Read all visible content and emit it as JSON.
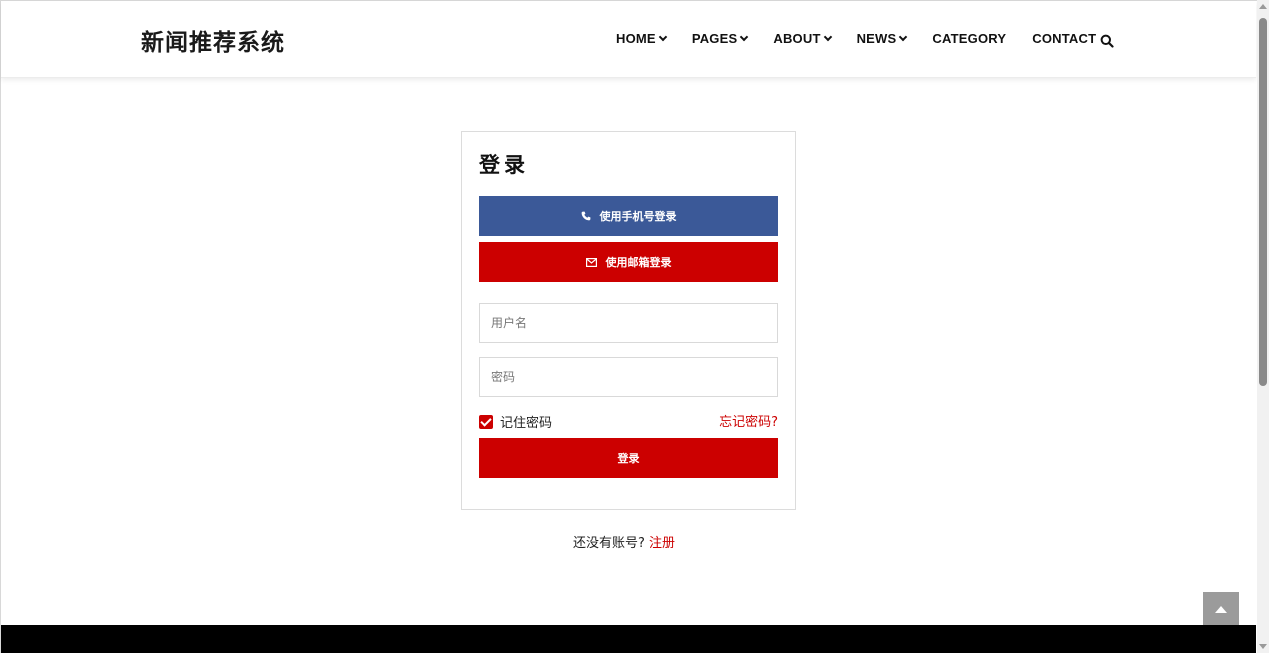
{
  "header": {
    "brand": "新闻推荐系统",
    "nav": [
      {
        "label": "HOME",
        "has_dropdown": true
      },
      {
        "label": "PAGES",
        "has_dropdown": true
      },
      {
        "label": "ABOUT",
        "has_dropdown": true
      },
      {
        "label": "NEWS",
        "has_dropdown": true
      },
      {
        "label": "CATEGORY",
        "has_dropdown": false
      },
      {
        "label": "CONTACT",
        "has_dropdown": false
      }
    ],
    "search_icon": "search-icon"
  },
  "login": {
    "title": "登录",
    "phone_button": "使用手机号登录",
    "phone_icon": "phone-icon",
    "email_button": "使用邮箱登录",
    "email_icon": "envelope-icon",
    "username_placeholder": "用户名",
    "password_placeholder": "密码",
    "remember_label": "记住密码",
    "remember_checked": true,
    "forgot_link": "忘记密码?",
    "submit_button": "登录"
  },
  "signup": {
    "prompt": "还没有账号?",
    "link": "注册"
  },
  "colors": {
    "primary_red": "#cc0000",
    "facebook_blue": "#3b5998",
    "footer": "#000000"
  }
}
